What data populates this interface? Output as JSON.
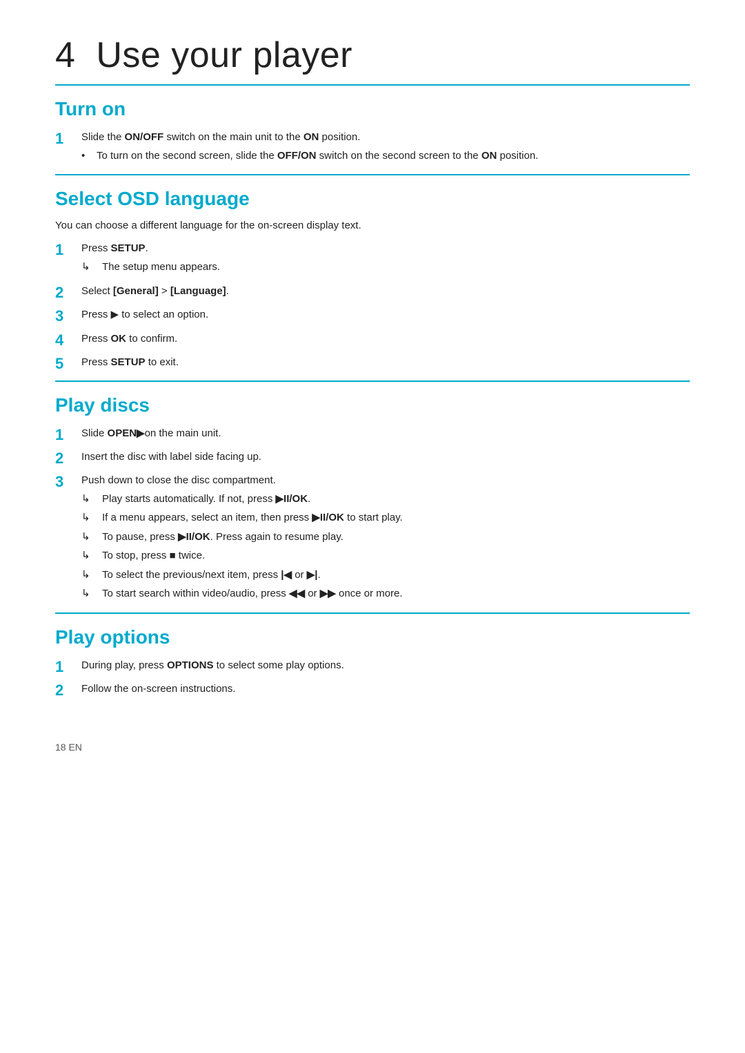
{
  "page": {
    "chapter": "4",
    "title": "Use your player",
    "footer": "18    EN"
  },
  "sections": {
    "turn_on": {
      "title": "Turn on",
      "steps": [
        {
          "num": "1",
          "text": "Slide the <b>ON/OFF</b> switch on the main unit to the <b>ON</b> position.",
          "sub": [
            "To turn on the second screen, slide the <b>OFF/ON</b> switch on the second screen to the <b>ON</b> position."
          ]
        }
      ]
    },
    "select_osd": {
      "title": "Select OSD language",
      "intro": "You can choose a different language for the on-screen display text.",
      "steps": [
        {
          "num": "1",
          "text": "Press <b>SETUP</b>.",
          "arrow": "The setup menu appears."
        },
        {
          "num": "2",
          "text": "Select <b>[General]</b> &gt; <b>[Language]</b>."
        },
        {
          "num": "3",
          "text": "Press ▶ to select an option."
        },
        {
          "num": "4",
          "text": "Press <b>OK</b> to confirm."
        },
        {
          "num": "5",
          "text": "Press <b>SETUP</b> to exit."
        }
      ]
    },
    "play_discs": {
      "title": "Play discs",
      "steps": [
        {
          "num": "1",
          "text": "Slide <b>OPEN▶</b>on the main unit."
        },
        {
          "num": "2",
          "text": "Insert the disc with label side facing up."
        },
        {
          "num": "3",
          "text": "Push down to close the disc compartment.",
          "arrows": [
            "Play starts automatically. If not, press ▶II/OK.",
            "If a menu appears, select an item, then press ▶II/OK to start play.",
            "To pause, press ▶II/OK. Press again to resume play.",
            "To stop, press ■ twice.",
            "To select the previous/next item, press |◀ or ▶|.",
            "To start search within video/audio, press ◀◀ or ▶▶ once or more."
          ]
        }
      ]
    },
    "play_options": {
      "title": "Play options",
      "steps": [
        {
          "num": "1",
          "text": "During play, press <b>OPTIONS</b> to select some play options."
        },
        {
          "num": "2",
          "text": "Follow the on-screen instructions."
        }
      ]
    }
  }
}
